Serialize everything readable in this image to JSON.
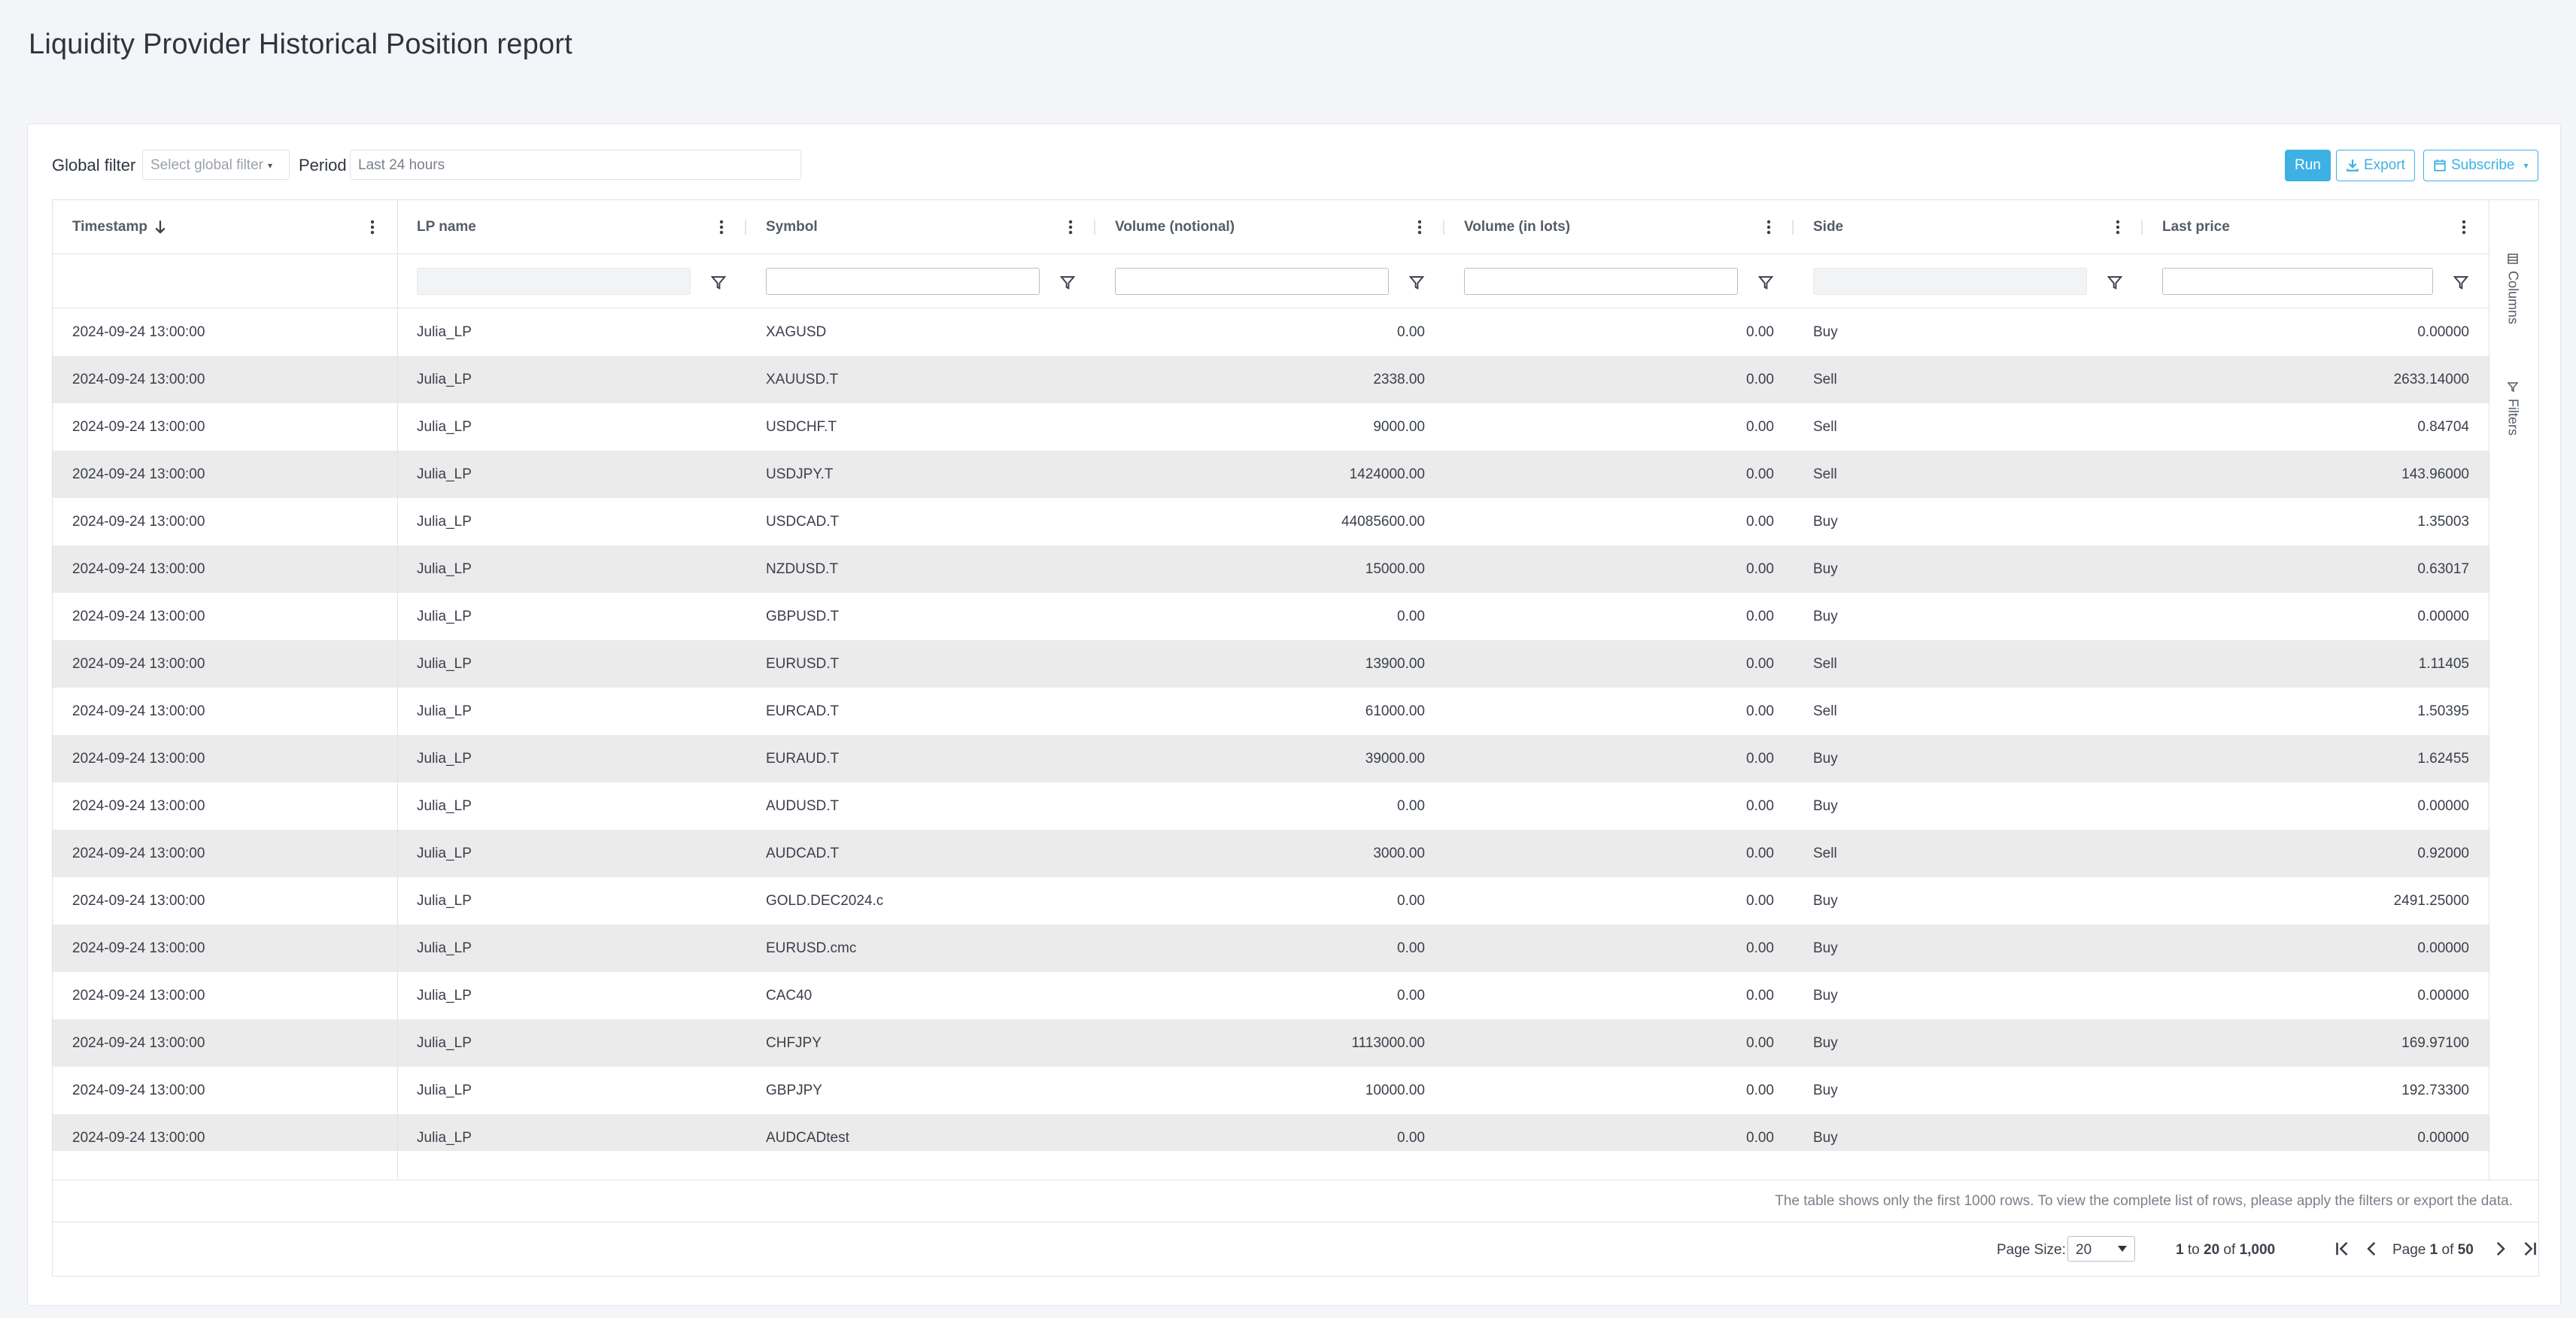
{
  "page": {
    "title": "Liquidity Provider Historical Position report"
  },
  "toolbar": {
    "global_filter_label": "Global filter",
    "global_filter_placeholder": "Select global filter",
    "period_label": "Period",
    "period_value": "Last 24 hours",
    "run_label": "Run",
    "export_label": "Export",
    "subscribe_label": "Subscribe"
  },
  "columns": [
    {
      "label": "Timestamp",
      "sorted": "desc"
    },
    {
      "label": "LP name"
    },
    {
      "label": "Symbol"
    },
    {
      "label": "Volume (notional)"
    },
    {
      "label": "Volume (in lots)"
    },
    {
      "label": "Side"
    },
    {
      "label": "Last price"
    }
  ],
  "rows": [
    [
      "2024-09-24 13:00:00",
      "Julia_LP",
      "XAGUSD",
      "0.00",
      "0.00",
      "Buy",
      "0.00000"
    ],
    [
      "2024-09-24 13:00:00",
      "Julia_LP",
      "XAUUSD.T",
      "2338.00",
      "0.00",
      "Sell",
      "2633.14000"
    ],
    [
      "2024-09-24 13:00:00",
      "Julia_LP",
      "USDCHF.T",
      "9000.00",
      "0.00",
      "Sell",
      "0.84704"
    ],
    [
      "2024-09-24 13:00:00",
      "Julia_LP",
      "USDJPY.T",
      "1424000.00",
      "0.00",
      "Sell",
      "143.96000"
    ],
    [
      "2024-09-24 13:00:00",
      "Julia_LP",
      "USDCAD.T",
      "44085600.00",
      "0.00",
      "Buy",
      "1.35003"
    ],
    [
      "2024-09-24 13:00:00",
      "Julia_LP",
      "NZDUSD.T",
      "15000.00",
      "0.00",
      "Buy",
      "0.63017"
    ],
    [
      "2024-09-24 13:00:00",
      "Julia_LP",
      "GBPUSD.T",
      "0.00",
      "0.00",
      "Buy",
      "0.00000"
    ],
    [
      "2024-09-24 13:00:00",
      "Julia_LP",
      "EURUSD.T",
      "13900.00",
      "0.00",
      "Sell",
      "1.11405"
    ],
    [
      "2024-09-24 13:00:00",
      "Julia_LP",
      "EURCAD.T",
      "61000.00",
      "0.00",
      "Sell",
      "1.50395"
    ],
    [
      "2024-09-24 13:00:00",
      "Julia_LP",
      "EURAUD.T",
      "39000.00",
      "0.00",
      "Buy",
      "1.62455"
    ],
    [
      "2024-09-24 13:00:00",
      "Julia_LP",
      "AUDUSD.T",
      "0.00",
      "0.00",
      "Buy",
      "0.00000"
    ],
    [
      "2024-09-24 13:00:00",
      "Julia_LP",
      "AUDCAD.T",
      "3000.00",
      "0.00",
      "Sell",
      "0.92000"
    ],
    [
      "2024-09-24 13:00:00",
      "Julia_LP",
      "GOLD.DEC2024.c",
      "0.00",
      "0.00",
      "Buy",
      "2491.25000"
    ],
    [
      "2024-09-24 13:00:00",
      "Julia_LP",
      "EURUSD.cmc",
      "0.00",
      "0.00",
      "Buy",
      "0.00000"
    ],
    [
      "2024-09-24 13:00:00",
      "Julia_LP",
      "CAC40",
      "0.00",
      "0.00",
      "Buy",
      "0.00000"
    ],
    [
      "2024-09-24 13:00:00",
      "Julia_LP",
      "CHFJPY",
      "1113000.00",
      "0.00",
      "Buy",
      "169.97100"
    ],
    [
      "2024-09-24 13:00:00",
      "Julia_LP",
      "GBPJPY",
      "10000.00",
      "0.00",
      "Buy",
      "192.73300"
    ],
    [
      "2024-09-24 13:00:00",
      "Julia_LP",
      "AUDCADtest",
      "0.00",
      "0.00",
      "Buy",
      "0.00000"
    ]
  ],
  "side_panel": {
    "columns_label": "Columns",
    "filters_label": "Filters"
  },
  "footer": {
    "note": "The table shows only the first 1000 rows. To view the complete list of rows, please apply the filters or export the data."
  },
  "pagination": {
    "page_size_label": "Page Size:",
    "page_size": "20",
    "from": "1",
    "to_word": "to",
    "to": "20",
    "of_word": "of",
    "total": "1,000",
    "page_word": "Page",
    "page": "1",
    "page_of_word": "of",
    "pages": "50"
  },
  "colors": {
    "accent": "#3db1e4",
    "stripe": "#ebebeb"
  }
}
